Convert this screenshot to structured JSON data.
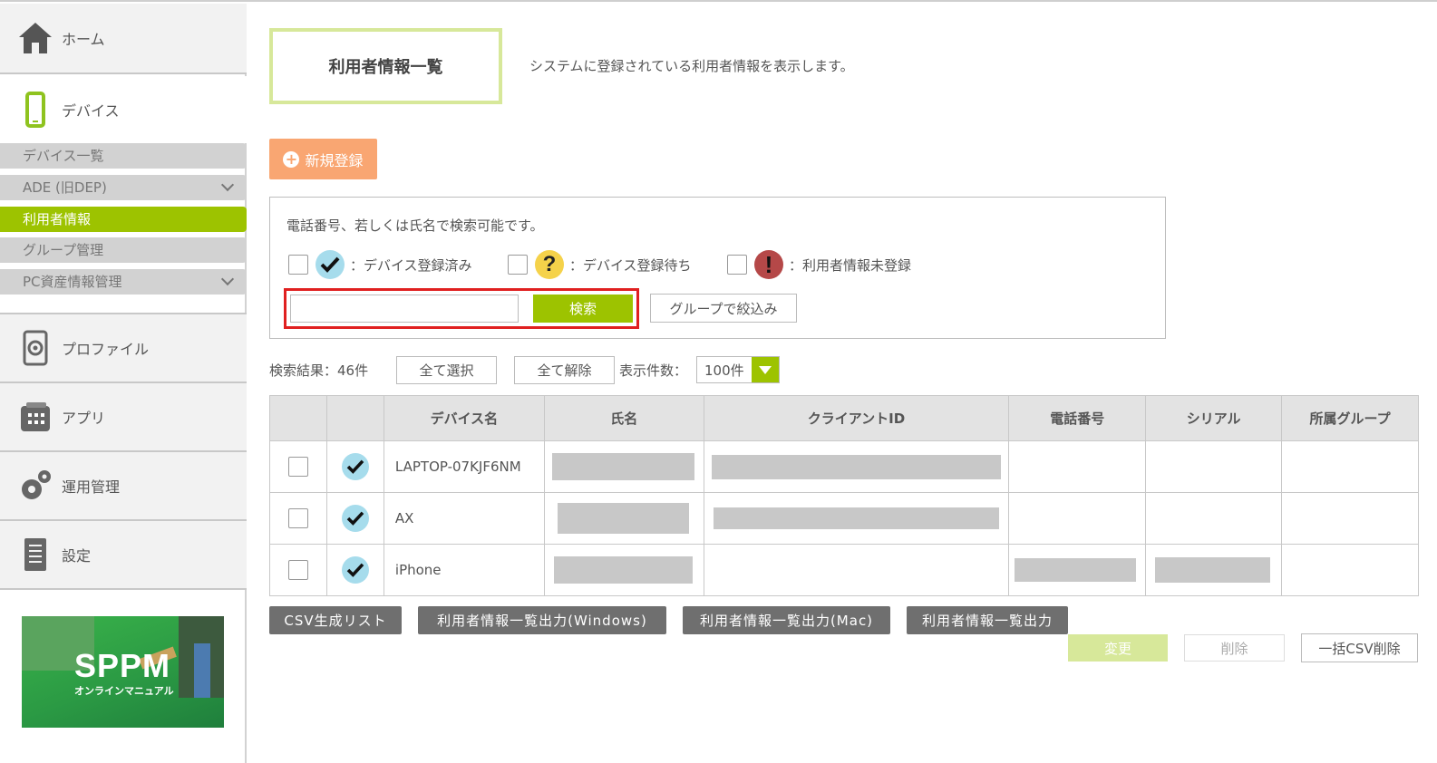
{
  "sidebar": {
    "home_label": "ホーム",
    "device_label": "デバイス",
    "sub_items": [
      {
        "label": "デバイス一覧"
      },
      {
        "label": "ADE (旧DEP)"
      },
      {
        "label": "利用者情報"
      },
      {
        "label": "グループ管理"
      },
      {
        "label": "PC資産情報管理"
      }
    ],
    "profile_label": "プロファイル",
    "app_label": "アプリ",
    "ops_label": "運用管理",
    "settings_label": "設定",
    "banner": {
      "title": "SPPM",
      "subtitle": "オンラインマニュアル"
    }
  },
  "header": {
    "title": "利用者情報一覧",
    "description": "システムに登録されている利用者情報を表示します。"
  },
  "new_button": "新規登録",
  "search": {
    "hint": "電話番号、若しくは氏名で検索可能です。",
    "filters": [
      {
        "label": "：デバイス登録済み",
        "status": "registered"
      },
      {
        "label": "：デバイス登録待ち",
        "status": "pending"
      },
      {
        "label": "：利用者情報未登録",
        "status": "unregistered"
      }
    ],
    "input_value": "",
    "search_button": "検索",
    "group_button": "グループで絞込み"
  },
  "results": {
    "count_label": "検索結果：46件",
    "select_all": "全て選択",
    "deselect_all": "全て解除",
    "per_page_label": "表示件数：",
    "per_page_value": "100件"
  },
  "table": {
    "columns": [
      "",
      "",
      "デバイス名",
      "氏名",
      "クライアントID",
      "電話番号",
      "シリアル",
      "所属グループ"
    ],
    "rows": [
      {
        "device": "LAPTOP-07KJF6NM",
        "name_redacted": true,
        "client_redacted": true,
        "phone_redacted": false,
        "serial_redacted": false
      },
      {
        "device": "AX",
        "name_redacted": true,
        "client_redacted": true,
        "phone_redacted": false,
        "serial_redacted": false
      },
      {
        "device": "iPhone",
        "name_redacted": true,
        "client_redacted": false,
        "phone_redacted": true,
        "serial_redacted": true
      }
    ]
  },
  "bottom": {
    "csv_list": "CSV生成リスト",
    "export_windows": "利用者情報一覧出力(Windows)",
    "export_mac": "利用者情報一覧出力(Mac)",
    "export_all": "利用者情報一覧出力",
    "change": "変更",
    "delete": "削除",
    "bulk_delete": "一括CSV削除"
  },
  "colors": {
    "accent": "#9dc300",
    "orange": "#f9a672",
    "dark_button": "#6f6f6f"
  }
}
